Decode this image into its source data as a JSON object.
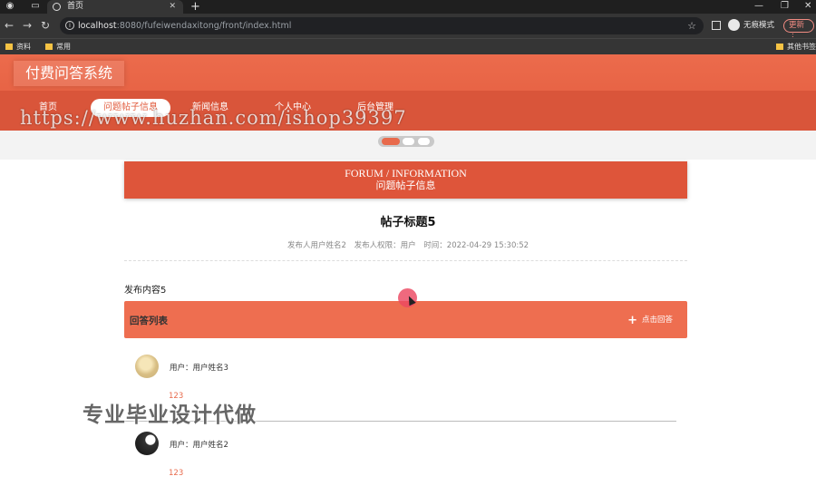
{
  "browser": {
    "tab_title": "首页",
    "url_host": "localhost",
    "url_rest": ":8080/fufeiwendaxitong/front/index.html",
    "incognito_label": "无痕模式",
    "update_label": "更新",
    "bookmarks": [
      "资料",
      "常用"
    ],
    "other_bookmarks": "其他书签"
  },
  "site": {
    "logo": "付费问答系统",
    "nav": [
      "首页",
      "问题帖子信息",
      "新闻信息",
      "个人中心",
      "后台管理"
    ],
    "active_nav_index": 1
  },
  "watermark": "https://www.huzhan.com/ishop39397",
  "overlay_text": "专业毕业设计代做",
  "section": {
    "en": "FORUM / INFORMATION",
    "cn": "问题帖子信息"
  },
  "post": {
    "title": "帖子标题5",
    "author": "发布人用户姓名2",
    "role": "发布人权限：用户",
    "time": "时间：2022-04-29 15:30:52",
    "body": "发布内容5"
  },
  "answers": {
    "title": "回答列表",
    "add_button": "点击回答",
    "items": [
      {
        "user": "用户：用户姓名3",
        "text": "123"
      },
      {
        "user": "用户：用户姓名2",
        "text": "123"
      }
    ]
  }
}
